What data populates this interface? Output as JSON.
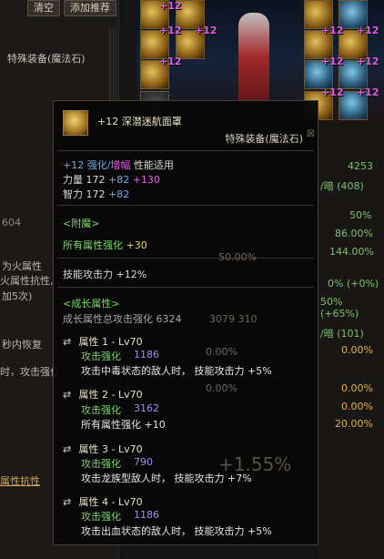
{
  "background": {
    "top_buttons": [
      "清空",
      "添加推荐"
    ],
    "left_label": "特殊装备(魔法石)",
    "left_snippets": [
      "604",
      "为火属性",
      "火属性抗性,",
      "加5次)",
      "秒内恢复",
      "时，攻击强化",
      "属性抗性"
    ],
    "equip_plus_labels": [
      "+12",
      "+12",
      "+12",
      "+12",
      "+12",
      "+12",
      "+12",
      "+12",
      "+12",
      "+12"
    ],
    "right_values": [
      "4253",
      "/暗 (408)",
      "50%",
      "86.00%",
      "144.00%",
      "0% (+0%)",
      "50% (+65%)",
      "/暗 (101)",
      "0.00%",
      "0.00%",
      "0.00%",
      "20.00%"
    ],
    "faded_text": [
      "3079 310",
      "50.00%",
      "0.00%",
      "0.00%",
      "+1.55%"
    ]
  },
  "tooltip": {
    "item_name": "+12 深潜迷航面罩",
    "item_type": "特殊装备(魔法石)",
    "enhance": {
      "prefix": "+12 强化/",
      "amp": "增幅",
      "suffix": " 性能适用"
    },
    "str": {
      "label": "力量 172 ",
      "plus1": "+82",
      "plus2": " +130"
    },
    "int": {
      "label": "智力 172 ",
      "plus1": "+82"
    },
    "enchant_header": "<附魔>",
    "enchant_value": {
      "label": "所有属性强化 ",
      "value": "+30"
    },
    "skill_atk": "技能攻击力 +12%",
    "growth_header": "<成长属性>",
    "growth_total": "成长属性总攻击强化 6324",
    "attributes": [
      {
        "title": "属性 1 - Lv70",
        "atk_label": "攻击强化",
        "atk_value": "1186",
        "effect": "攻击中毒状态的敌人时， 技能攻击力 +5%"
      },
      {
        "title": "属性 2 - Lv70",
        "atk_label": "攻击强化",
        "atk_value": "3162",
        "effect": "所有属性强化 +10"
      },
      {
        "title": "属性 3 - Lv70",
        "atk_label": "攻击强化",
        "atk_value": "790",
        "effect": "攻击龙族型敌人时， 技能攻击力 +7%"
      },
      {
        "title": "属性 4 - Lv70",
        "atk_label": "攻击强化",
        "atk_value": "1186",
        "effect": "攻击出血状态的敌人时， 技能攻击力 +5%"
      }
    ]
  }
}
